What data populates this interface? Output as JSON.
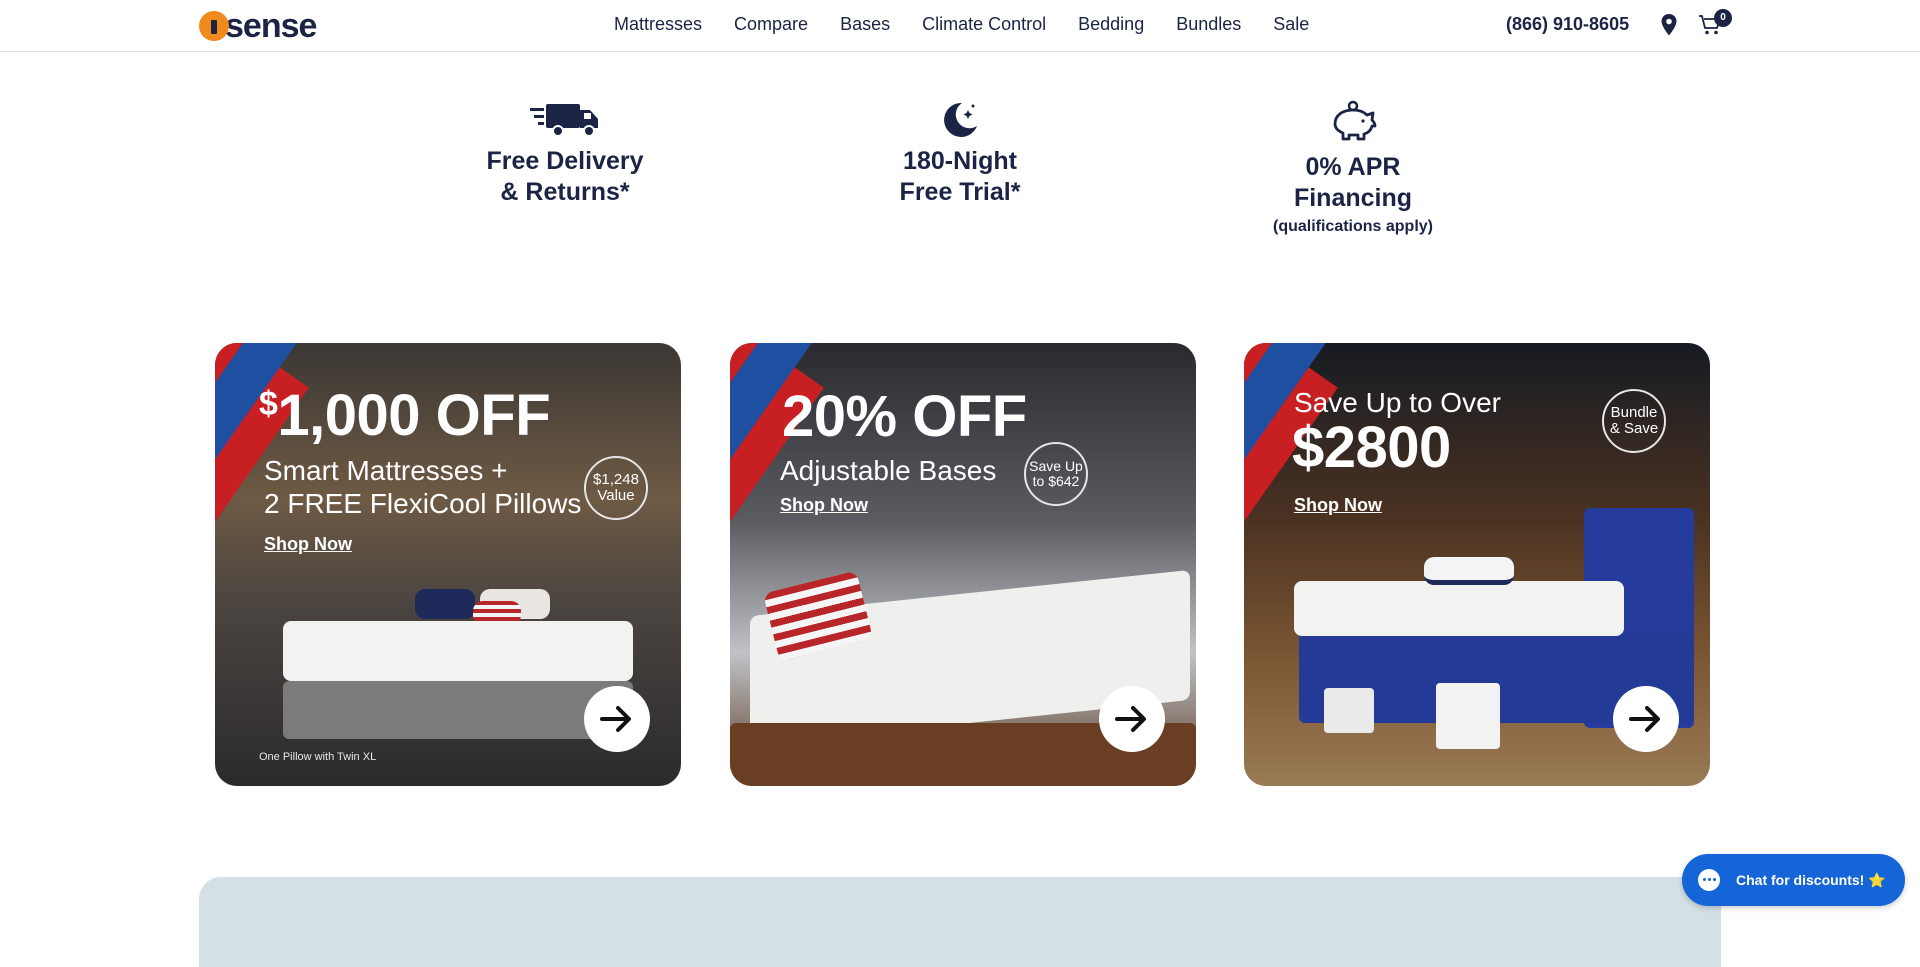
{
  "header": {
    "logo_text": "sense",
    "nav": [
      "Mattresses",
      "Compare",
      "Bases",
      "Climate Control",
      "Bedding",
      "Bundles",
      "Sale"
    ],
    "phone": "(866) 910-8605",
    "cart_count": "0"
  },
  "features": {
    "delivery": {
      "line1": "Free Delivery",
      "line2": "& Returns*"
    },
    "trial": {
      "line1": "180-Night",
      "line2": "Free Trial*"
    },
    "financing": {
      "line1": "0% APR",
      "line2": "Financing",
      "note": "(qualifications apply)"
    }
  },
  "promos": [
    {
      "currency": "$",
      "headline": "1,000 OFF",
      "sub1": "Smart Mattresses +",
      "sub2": "2 FREE FlexiCool Pillows",
      "badge1": "$1,248",
      "badge2": "Value",
      "cta": "Shop Now",
      "fineprint": "One Pillow with Twin XL"
    },
    {
      "headline": "20% OFF",
      "sub1": "Adjustable Bases",
      "badge1": "Save Up",
      "badge2": "to $642",
      "cta": "Shop Now"
    },
    {
      "pre": "Save Up to Over",
      "headline": "$2800",
      "badge1": "Bundle",
      "badge2": "& Save",
      "cta": "Shop Now"
    }
  ],
  "chat": {
    "label": "Chat for discounts! ⭐"
  },
  "colors": {
    "brand_navy": "#1c2445",
    "brand_orange": "#f08a1c",
    "chat_blue": "#1665d8",
    "stripe_red": "#c71f22",
    "stripe_blue": "#1e4fa0"
  }
}
